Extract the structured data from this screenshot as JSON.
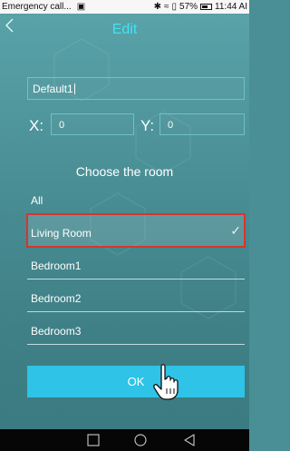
{
  "status_bar": {
    "notification": "Emergency call...",
    "time": "11:44 AI",
    "battery": "57%",
    "battery_level": 0.57
  },
  "header": {
    "back_glyph": "<",
    "title": "Edit"
  },
  "form": {
    "name_value": "Default1",
    "x_label": "X:",
    "x_value": "0",
    "y_label": "Y:",
    "y_value": "0"
  },
  "rooms": {
    "title": "Choose the room",
    "items": [
      {
        "label": "All",
        "selected": false
      },
      {
        "label": "Living Room",
        "selected": true
      },
      {
        "label": "Bedroom1",
        "selected": false
      },
      {
        "label": "Bedroom2",
        "selected": false
      },
      {
        "label": "Bedroom3",
        "selected": false
      }
    ],
    "check_glyph": "✓"
  },
  "actions": {
    "ok_label": "OK"
  },
  "icons": {
    "back": "chevron-left-icon",
    "check": "check-icon",
    "cursor": "hand-pointer-icon",
    "nav_recent": "square-icon",
    "nav_home": "circle-icon",
    "nav_back": "triangle-back-icon"
  },
  "colors": {
    "title": "#41e3f4",
    "ok_button": "#2ec3e7",
    "selection_outline": "#d9342b",
    "background": "#4c9198"
  }
}
